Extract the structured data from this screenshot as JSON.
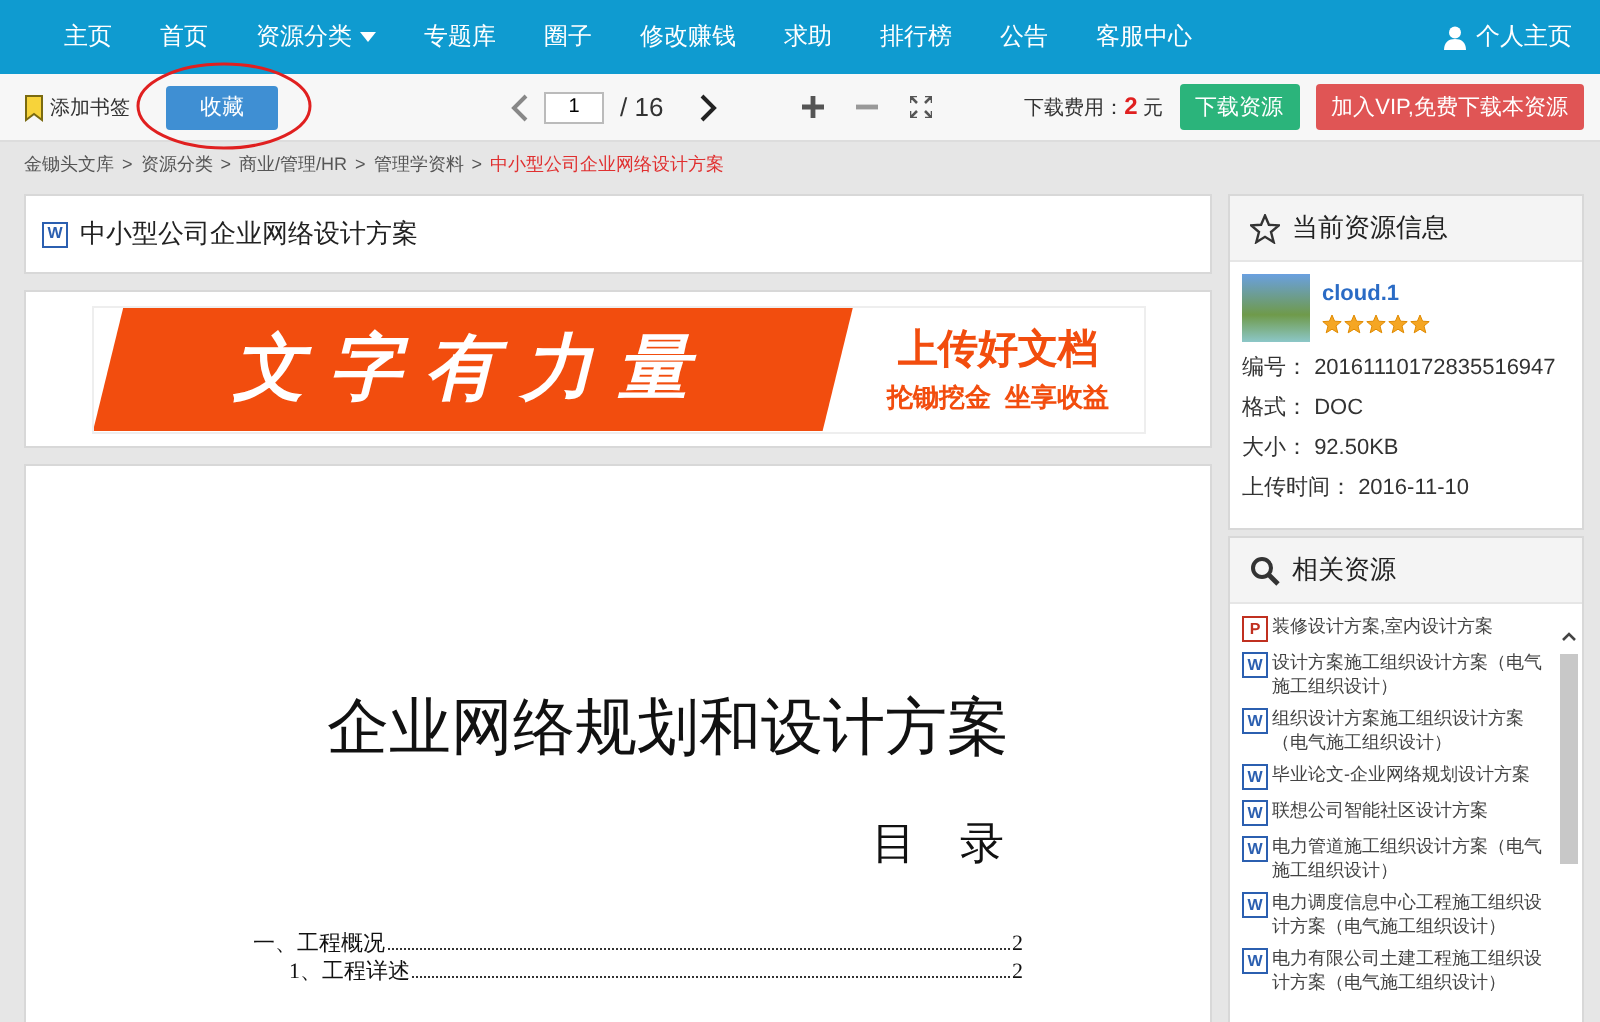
{
  "nav": {
    "items": [
      {
        "label": "主页",
        "has_menu": false
      },
      {
        "label": "首页",
        "has_menu": false
      },
      {
        "label": "资源分类",
        "has_menu": true
      },
      {
        "label": "专题库",
        "has_menu": false
      },
      {
        "label": "圈子",
        "has_menu": false
      },
      {
        "label": "修改赚钱",
        "has_menu": false
      },
      {
        "label": "求助",
        "has_menu": false
      },
      {
        "label": "排行榜",
        "has_menu": false
      },
      {
        "label": "公告",
        "has_menu": false
      },
      {
        "label": "客服中心",
        "has_menu": false
      }
    ],
    "user_link": "个人主页"
  },
  "toolbar": {
    "bookmark": "添加书签",
    "favorite": "收藏",
    "page": "1",
    "page_total": "/ 16",
    "fee_label": "下载费用：",
    "fee_value": "2",
    "fee_unit": "元",
    "download": "下载资源",
    "vip": "加入VIP,免费下载本资源"
  },
  "breadcrumb": [
    {
      "kind": "link",
      "label": "金锄头文库"
    },
    {
      "kind": "separator",
      "label": ">"
    },
    {
      "kind": "link",
      "label": "资源分类"
    },
    {
      "kind": "separator",
      "label": ">"
    },
    {
      "kind": "link",
      "label": "商业/管理/HR"
    },
    {
      "kind": "separator",
      "label": ">"
    },
    {
      "kind": "link",
      "label": "管理学资料"
    },
    {
      "kind": "separator",
      "label": ">"
    },
    {
      "kind": "current",
      "label": "中小型公司企业网络设计方案"
    }
  ],
  "document": {
    "icon_letter": "W",
    "title": "中小型公司企业网络设计方案"
  },
  "banner": {
    "headline": "文字有力量",
    "slogan": "上传好文档",
    "subline": "抡锄挖金  坐享收益"
  },
  "page": {
    "title": "企业网络规划和设计方案",
    "toc_heading": "目　录",
    "toc": [
      {
        "label": "一、工程概况",
        "page": "2",
        "children": [
          {
            "label": "1、工程详述",
            "page": "2"
          }
        ]
      }
    ]
  },
  "resource_info": {
    "heading": "当前资源信息",
    "uploader": "cloud.1",
    "stars": 5,
    "fields": [
      {
        "label": "编号：",
        "value": "20161110172835516947"
      },
      {
        "label": "格式：",
        "value": "DOC"
      },
      {
        "label": "大小：",
        "value": "92.50KB"
      },
      {
        "label": "上传时间：",
        "value": "2016-11-10"
      }
    ]
  },
  "related": {
    "heading": "相关资源",
    "items": [
      {
        "kind": "ppt",
        "icon_letter": "P",
        "title": "装修设计方案,室内设计方案"
      },
      {
        "kind": "doc",
        "icon_letter": "W",
        "title": "设计方案施工组织设计方案（电气施工组织设计）"
      },
      {
        "kind": "doc",
        "icon_letter": "W",
        "title": "组织设计方案施工组织设计方案（电气施工组织设计）"
      },
      {
        "kind": "doc",
        "icon_letter": "W",
        "title": "毕业论文-企业网络规划设计方案"
      },
      {
        "kind": "doc",
        "icon_letter": "W",
        "title": "联想公司智能社区设计方案"
      },
      {
        "kind": "doc",
        "icon_letter": "W",
        "title": "电力管道施工组织设计方案（电气施工组织设计）"
      },
      {
        "kind": "doc",
        "icon_letter": "W",
        "title": "电力调度信息中心工程施工组织设计方案（电气施工组织设计）"
      },
      {
        "kind": "doc",
        "icon_letter": "W",
        "title": "电力有限公司土建工程施工组织设计方案（电气施工组织设计）"
      }
    ]
  }
}
